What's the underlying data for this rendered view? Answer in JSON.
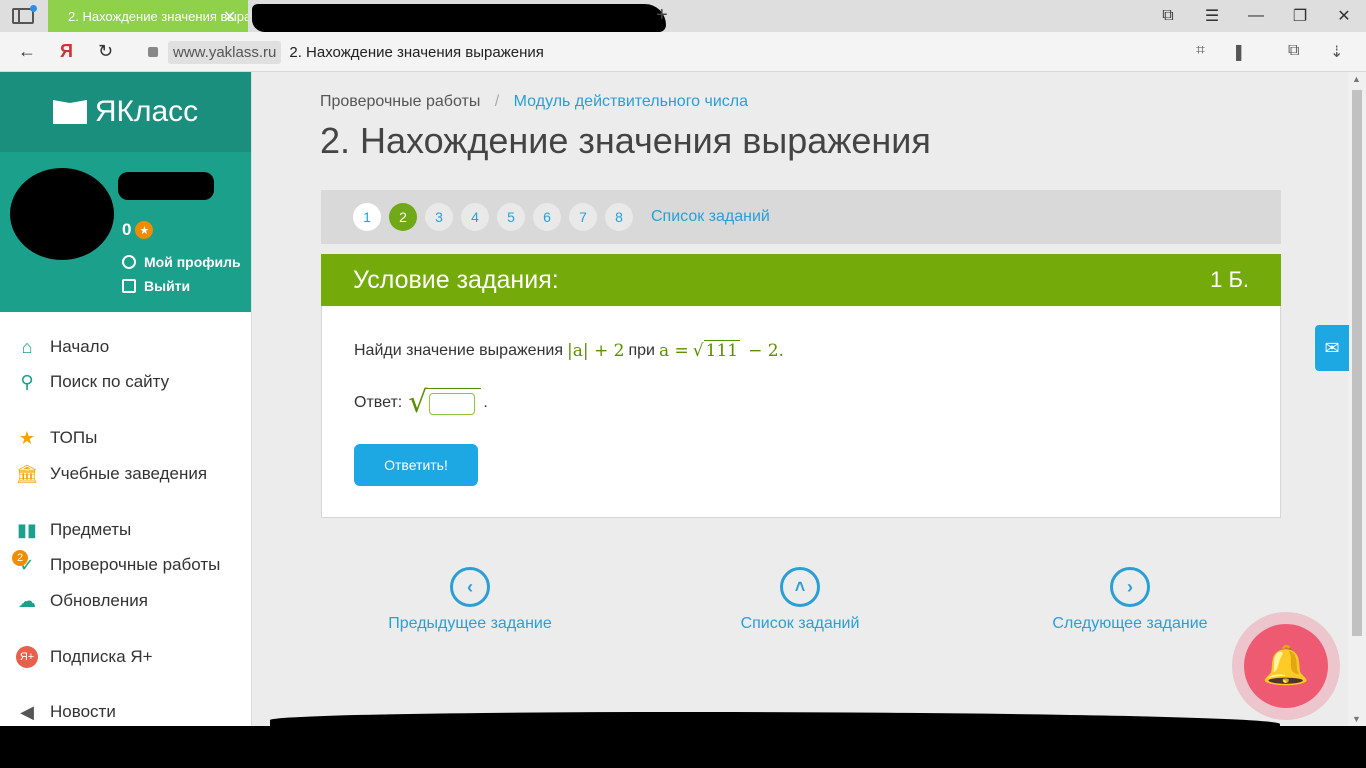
{
  "browser": {
    "tab_title": "2. Нахождение значения выражения",
    "url_host": "www.yaklass.ru",
    "page_title": "2. Нахождение значения выражения"
  },
  "sidebar": {
    "logo": "ЯКласс",
    "score": "0",
    "profile_link": "Мой профиль",
    "logout_link": "Выйти",
    "menu": [
      {
        "label": "Начало",
        "icon": "home-icon"
      },
      {
        "label": "Поиск по сайту",
        "icon": "search-icon"
      },
      {
        "label": "ТОПы",
        "icon": "star-icon"
      },
      {
        "label": "Учебные заведения",
        "icon": "school-icon"
      },
      {
        "label": "Предметы",
        "icon": "books-icon"
      },
      {
        "label": "Проверочные работы",
        "icon": "check-icon",
        "badge": "2"
      },
      {
        "label": "Обновления",
        "icon": "cloud-icon"
      },
      {
        "label": "Подписка Я+",
        "icon": "yaplus-icon"
      },
      {
        "label": "Новости",
        "icon": "megaphone-icon"
      }
    ]
  },
  "breadcrumb": {
    "root": "Проверочные работы",
    "current": "Модуль действительного числа"
  },
  "page": {
    "title": "2. Нахождение значения выражения"
  },
  "stepper": {
    "steps": [
      "1",
      "2",
      "3",
      "4",
      "5",
      "6",
      "7",
      "8"
    ],
    "current": "2",
    "list_link": "Список заданий"
  },
  "task": {
    "header": "Условие задания:",
    "points": "1 Б.",
    "question_text": "Найди значение выражения",
    "expr_abs": "|a| + 2",
    "word_at": "при",
    "expr_a": "a =",
    "sqrt_arg": "111",
    "expr_tail": "− 2.",
    "answer_label": "Ответ:",
    "answer_value": "",
    "answer_dot": ".",
    "submit": "Ответить!"
  },
  "nav": {
    "prev": "Предыдущее задание",
    "list": "Список заданий",
    "next": "Следующее задание"
  },
  "colors": {
    "brand_green": "#74aa0a",
    "teal": "#1aa08b",
    "link_blue": "#2a9fd6",
    "button_blue": "#1da7e3"
  }
}
